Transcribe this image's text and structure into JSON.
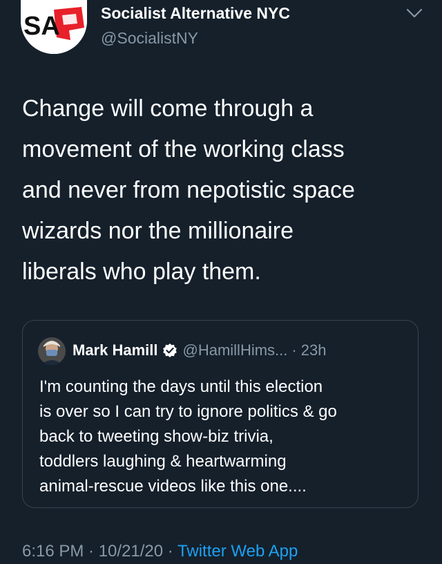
{
  "tweet": {
    "author_name": "Socialist Alternative NYC",
    "author_handle": "@SocialistNY",
    "avatar_logo_text": "SA",
    "text": "Change will come through a\nmovement of the working class\nand never from nepotistic space\nwizards nor the millionaire\nliberals who play them.",
    "timestamp": "6:16 PM · 10/21/20 · ",
    "source_app": "Twitter Web App",
    "icons": {
      "menu": "chevron-down-icon",
      "verified": "verified-badge-icon"
    },
    "colors": {
      "background": "#15202b",
      "secondary_text": "#8899a6",
      "link": "#1da1f2",
      "border": "#38444d",
      "logo_red": "#e8202a"
    }
  },
  "quoted": {
    "author_name": "Mark Hamill",
    "author_handle": "@HamillHims...",
    "separator": "·",
    "time": "23h",
    "text": "I'm counting the days until this election\nis over so I can try to ignore politics & go\nback to tweeting show-biz trivia,\ntoddlers laughing & heartwarming\nanimal-rescue videos like this one...."
  }
}
